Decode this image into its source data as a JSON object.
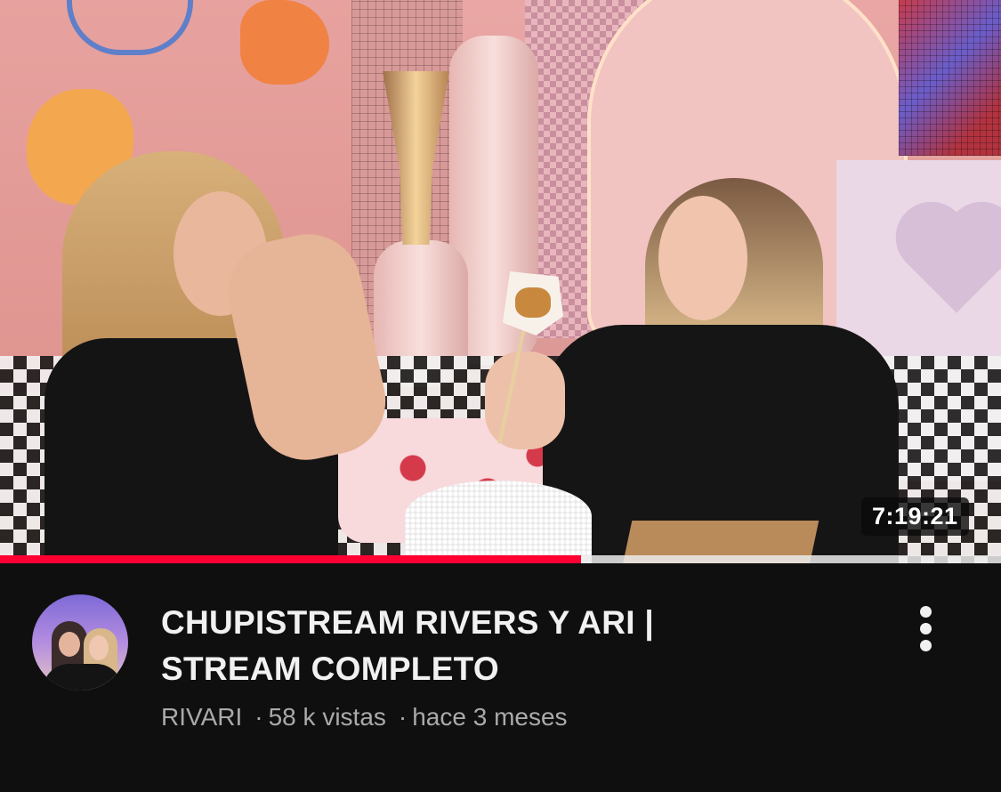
{
  "video": {
    "duration": "7:19:21",
    "watched_fraction": 0.58,
    "title_line1": "CHUPISTREAM RIVERS Y ARI |",
    "title_line2": "STREAM COMPLETO",
    "channel": "RIVARI",
    "separator": "·",
    "views": "58 k vistas",
    "age": "hace 3 meses"
  },
  "icons": {
    "more": "more-vertical-icon"
  },
  "colors": {
    "background": "#0f0f0f",
    "progress": "#ff0033",
    "title": "#f1f1f1",
    "meta": "#aaaaaa"
  }
}
